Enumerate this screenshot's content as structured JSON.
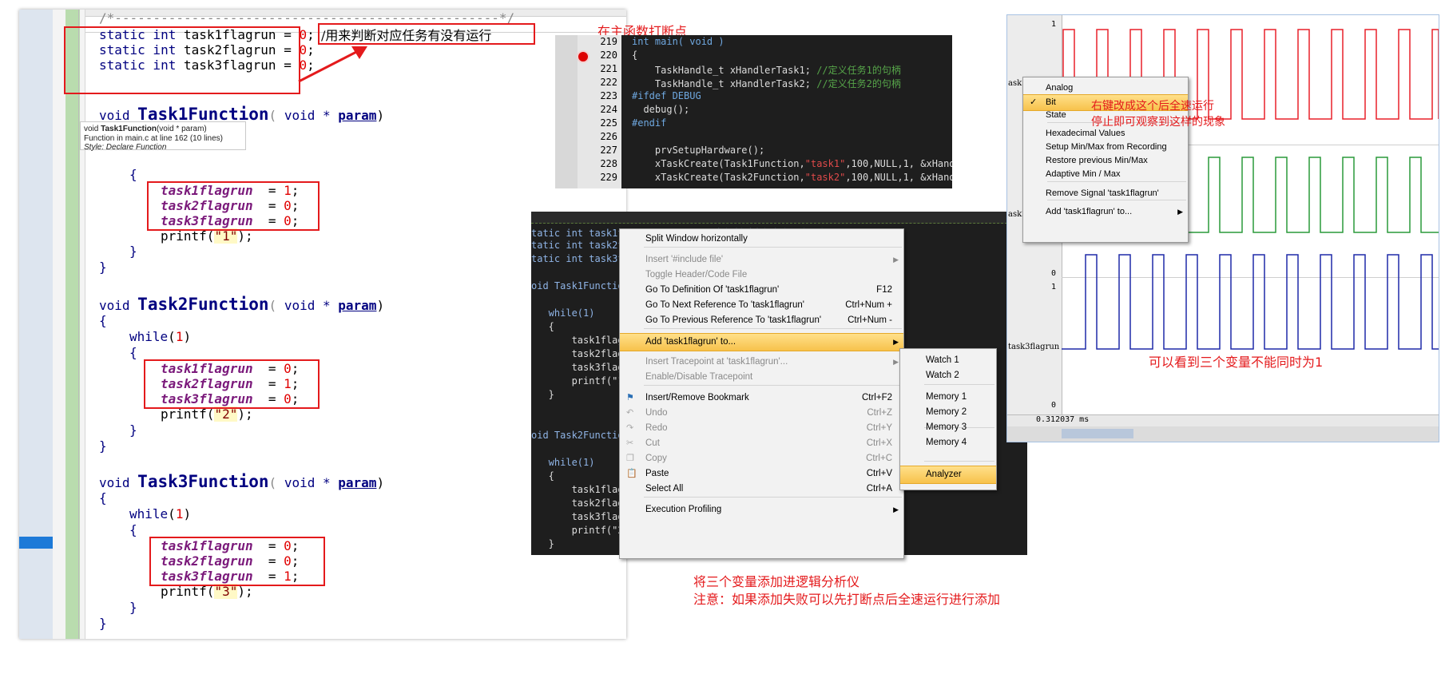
{
  "editor": {
    "comment_line": "/*--------------------------------------------------*/",
    "globals": [
      {
        "kw": "static int",
        "name": "task1flagrun",
        "eq": " = ",
        "val": "0",
        "end": ";"
      },
      {
        "kw": "static int",
        "name": "task2flagrun",
        "eq": " = ",
        "val": "0",
        "end": ";"
      },
      {
        "kw": "static int",
        "name": "task3flagrun",
        "eq": " = ",
        "val": "0",
        "end": ";"
      }
    ],
    "globals_comment": "/用来判断对应任务有没有运行",
    "void_kw": "void",
    "void_param": "void * ",
    "param": "param",
    "funcs": [
      "Task1Function",
      "Task2Function",
      "Task3Function"
    ],
    "paren_open": "(",
    "paren_close": ")",
    "brace_open": "{",
    "brace_close": "}",
    "while_kw": "while",
    "one": "1",
    "var_names": [
      "task1flagrun",
      "task2flagrun",
      "task3flagrun"
    ],
    "assign": "  = ",
    "semi": ";",
    "printf_kw": "printf",
    "printf_args": [
      "\"1\"",
      "\"2\"",
      "\"3\""
    ],
    "assign_values": [
      [
        "1",
        "0",
        "0"
      ],
      [
        "0",
        "1",
        "0"
      ],
      [
        "0",
        "0",
        "1"
      ]
    ],
    "tooltip": {
      "signature_pre": "void ",
      "signature_name": "Task1Function",
      "signature_post": "(void * param)",
      "location": "Function in main.c at line 162 (10 lines)",
      "style": "Style: Declare Function"
    }
  },
  "debug_view": {
    "lines": [
      {
        "no": "219",
        "code": "int main( void )"
      },
      {
        "no": "220",
        "code": "{"
      },
      {
        "no": "221",
        "code": "    TaskHandle_t xHandlerTask1; ",
        "comment": "//定义任务1的句柄"
      },
      {
        "no": "222",
        "code": "    TaskHandle_t xHandlerTask2; ",
        "comment": "//定义任务2的句柄"
      },
      {
        "no": "223",
        "code": "#ifdef DEBUG"
      },
      {
        "no": "224",
        "code": "  debug();"
      },
      {
        "no": "225",
        "code": "#endif"
      },
      {
        "no": "226",
        "code": ""
      },
      {
        "no": "227",
        "code": "    prvSetupHardware();"
      },
      {
        "no": "228",
        "code": "    xTaskCreate(Task1Function,",
        "str": "\"task1\"",
        "rest": ",100,NULL,1, &xHandl"
      },
      {
        "no": "229",
        "code": "    xTaskCreate(Task2Function,",
        "str": "\"task2\"",
        "rest": ",100,NULL,1, &xHandl"
      }
    ]
  },
  "context_code": {
    "lines": [
      "tatic int task1flagrun  = 0;//用来判断对应任务有没有运行",
      "tatic int task2f",
      "tatic int task3f",
      "",
      "oid Task1Functio",
      "",
      "   while(1)",
      "   {",
      "       task1flag",
      "       task2flag",
      "       task3flag",
      "       printf(\"1",
      "   }",
      "",
      "",
      "oid Task2Functio",
      "",
      "   while(1)",
      "   {",
      "       task1flag",
      "       task2flag",
      "       task3flag",
      "       printf(\"2",
      "   }"
    ]
  },
  "context_menu": {
    "items": [
      {
        "label": "Split Window horizontally",
        "shortcut": "",
        "state": "enabled"
      },
      {
        "label": "Insert '#include file'",
        "shortcut": "",
        "state": "disabled",
        "submenu": true
      },
      {
        "label": "Toggle Header/Code File",
        "shortcut": "",
        "state": "disabled"
      },
      {
        "label": "Go To Definition Of 'task1flagrun'",
        "shortcut": "F12",
        "state": "enabled"
      },
      {
        "label": "Go To Next Reference To 'task1flagrun'",
        "shortcut": "Ctrl+Num +",
        "state": "enabled"
      },
      {
        "label": "Go To Previous Reference To 'task1flagrun'",
        "shortcut": "Ctrl+Num -",
        "state": "enabled"
      },
      {
        "label": "Add 'task1flagrun' to...",
        "shortcut": "",
        "state": "highlighted",
        "submenu": true
      },
      {
        "label": "Insert Tracepoint at 'task1flagrun'...",
        "shortcut": "",
        "state": "disabled",
        "submenu": true
      },
      {
        "label": "Enable/Disable Tracepoint",
        "shortcut": "",
        "state": "disabled"
      },
      {
        "label": "Insert/Remove Bookmark",
        "shortcut": "Ctrl+F2",
        "state": "enabled"
      },
      {
        "label": "Undo",
        "shortcut": "Ctrl+Z",
        "state": "disabled"
      },
      {
        "label": "Redo",
        "shortcut": "Ctrl+Y",
        "state": "disabled"
      },
      {
        "label": "Cut",
        "shortcut": "Ctrl+X",
        "state": "disabled"
      },
      {
        "label": "Copy",
        "shortcut": "Ctrl+C",
        "state": "disabled"
      },
      {
        "label": "Paste",
        "shortcut": "Ctrl+V",
        "state": "enabled"
      },
      {
        "label": "Select All",
        "shortcut": "Ctrl+A",
        "state": "enabled"
      },
      {
        "label": "Execution Profiling",
        "shortcut": "",
        "state": "enabled",
        "submenu": true
      }
    ],
    "submenu": [
      "Watch 1",
      "Watch 2",
      "Memory 1",
      "Memory 2",
      "Memory 3",
      "Memory 4",
      "Analyzer"
    ],
    "submenu_selected": "Analyzer"
  },
  "analyzer": {
    "signal_labels": [
      "ask1f",
      "ask2f",
      "task3flagrun"
    ],
    "axis_labels": {
      "top": "1",
      "bottom": "0"
    },
    "time_readout": "0.312037 ms",
    "colors": {
      "task1": "#e8202a",
      "task2": "#2a9a3a",
      "task3": "#1e2aa8"
    },
    "context_menu": {
      "items": [
        "Analog",
        "Bit",
        "State",
        "Hexadecimal Values",
        "Setup Min/Max from Recording",
        "Restore previous Min/Max",
        "Adaptive Min / Max",
        "Remove Signal 'task1flagrun'",
        "Add 'task1flagrun' to..."
      ],
      "checked": "Bit",
      "checkmark": "✓"
    }
  },
  "annotations": {
    "main_breakpoint": "在主函数打断点",
    "right_click_line1": "右键改成这个后全速运行",
    "right_click_line2": "停止即可观察到这样的现象",
    "not_simultaneous": "可以看到三个变量不能同时为1",
    "add_line1": "将三个变量添加进逻辑分析仪",
    "add_line2": "注意：如果添加失败可以先打断点后全速运行进行添加"
  }
}
